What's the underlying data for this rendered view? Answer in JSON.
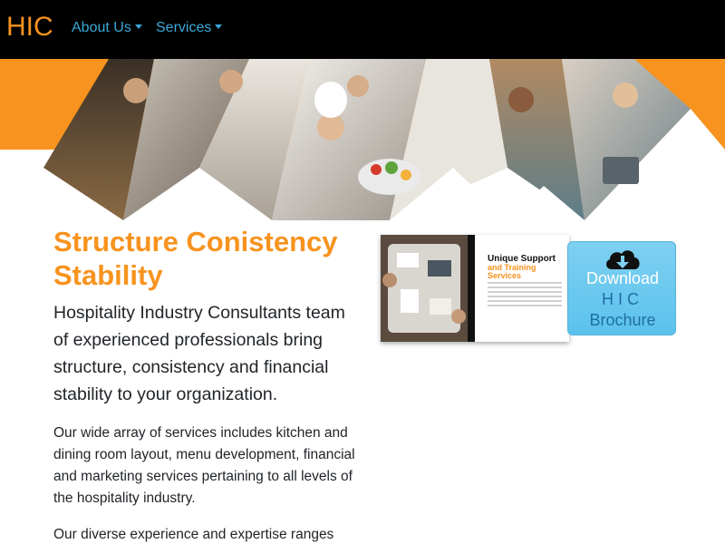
{
  "navbar": {
    "brand": "HIC",
    "links": [
      {
        "label": "About Us"
      },
      {
        "label": "Services"
      }
    ]
  },
  "hero": {
    "image_icon": "collage-hospitality-staff-image"
  },
  "main": {
    "headline": "Structure Conistency Stability",
    "lead": "Hospitality Industry Consultants team of experienced professionals bring structure, consistency and financial stability to your organization.",
    "paragraphs": [
      "Our wide array of services includes kitchen and dining room layout, menu development, financial and marketing services pertaining to all levels of the hospitality industry.",
      "Our diverse experience and expertise ranges"
    ]
  },
  "brochure": {
    "cover_title": "Unique Support",
    "cover_subtitle": "and Training Services",
    "download_line1": "Download",
    "download_line2": "HIC",
    "download_line3": "Brochure",
    "icon": "cloud-download-icon"
  },
  "colors": {
    "brand_orange": "#f7931e",
    "nav_link": "#3aa8d8",
    "download_bg": "#5bc2ec"
  }
}
